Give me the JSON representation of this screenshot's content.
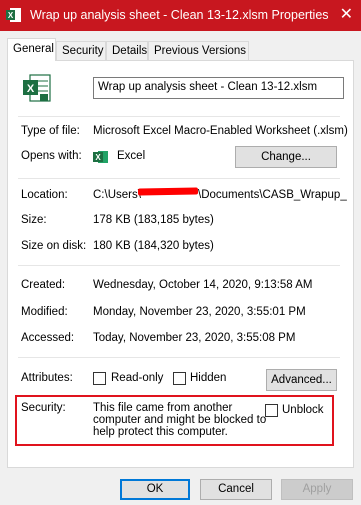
{
  "window": {
    "title": "Wrap up analysis sheet - Clean 13-12.xlsm Properties",
    "close_glyph": "✕"
  },
  "tabs": [
    {
      "label": "General",
      "active": true
    },
    {
      "label": "Security",
      "active": false
    },
    {
      "label": "Details",
      "active": false
    },
    {
      "label": "Previous Versions",
      "active": false
    }
  ],
  "general": {
    "filename": "Wrap up analysis sheet - Clean 13-12.xlsm",
    "type_label": "Type of file:",
    "type_value": "Microsoft Excel Macro-Enabled Worksheet (.xlsm)",
    "opens_label": "Opens with:",
    "opens_value": "Excel",
    "change_button": "Change...",
    "location_label": "Location:",
    "location_prefix": "C:\\Users\\",
    "location_suffix": "\\Documents\\CASB_Wrapup_",
    "size_label": "Size:",
    "size_value": "178 KB (183,185 bytes)",
    "size_disk_label": "Size on disk:",
    "size_disk_value": "180 KB (184,320 bytes)",
    "created_label": "Created:",
    "created_value": "Wednesday, October 14, 2020, 9:13:58 AM",
    "modified_label": "Modified:",
    "modified_value": "Monday, November 23, 2020, 3:55:01 PM",
    "accessed_label": "Accessed:",
    "accessed_value": "Today, November 23, 2020, 3:55:08 PM",
    "attributes_label": "Attributes:",
    "readonly_label": "Read-only",
    "hidden_label": "Hidden",
    "advanced_button": "Advanced...",
    "security_label": "Security:",
    "security_line1": "This file came from another",
    "security_line2": "computer and might be blocked to",
    "security_line3": "help protect this computer.",
    "unblock_label": "Unblock"
  },
  "footer": {
    "ok": "OK",
    "cancel": "Cancel",
    "apply": "Apply"
  },
  "colors": {
    "titlebar": "#c8171f",
    "highlight_border": "#e0131d",
    "excel_green": "#1d6f42"
  },
  "icons": {
    "title_icon": "excel-macro-icon",
    "file_icon": "excel-macro-file-icon",
    "opens_icon": "excel-icon"
  }
}
